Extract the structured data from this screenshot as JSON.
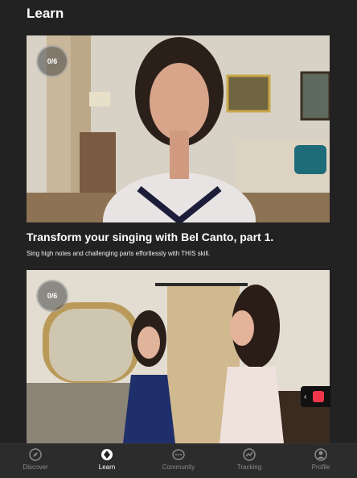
{
  "page": {
    "title": "Learn"
  },
  "cards": [
    {
      "progress": "0/6",
      "title": "Transform your singing with Bel Canto, part 1.",
      "subtitle": "Sing high notes and challenging parts effortlessly with THIS skill."
    },
    {
      "progress": "0/6"
    }
  ],
  "nav": {
    "items": [
      {
        "label": "Discover",
        "icon": "compass-icon"
      },
      {
        "label": "Learn",
        "icon": "learn-icon",
        "active": true
      },
      {
        "label": "Community",
        "icon": "chat-icon"
      },
      {
        "label": "Tracking",
        "icon": "tracking-icon"
      },
      {
        "label": "Profile",
        "icon": "profile-icon"
      }
    ]
  },
  "colors": {
    "background": "#222222",
    "nav_bg": "#2c2c2c",
    "active": "#ffffff",
    "inactive": "#8a8a8a",
    "accent": "#f0364a"
  }
}
